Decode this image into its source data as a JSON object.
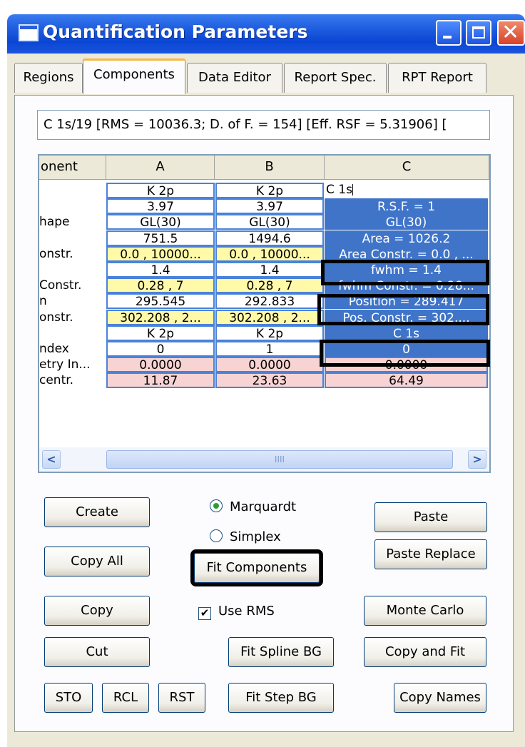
{
  "window": {
    "title": "Quantification Parameters"
  },
  "tabs": [
    "Regions",
    "Components",
    "Data Editor",
    "Report Spec.",
    "RPT Report"
  ],
  "summary": "C 1s/19 [RMS = 10036.3; D. of F. = 154] [Eff. RSF = 5.31906] [",
  "grid": {
    "headers": [
      "onent",
      "A",
      "B",
      "C"
    ],
    "rows": [
      {
        "label": "",
        "a": "K 2p",
        "b": "K 2p",
        "c": "C 1s"
      },
      {
        "label": "",
        "a": "3.97",
        "b": "3.97",
        "c": "R.S.F. = 1"
      },
      {
        "label": "hape",
        "a": "GL(30)",
        "b": "GL(30)",
        "c": "GL(30)"
      },
      {
        "label": "",
        "a": "751.5",
        "b": "1494.6",
        "c": "Area = 1026.2"
      },
      {
        "label": "onstr.",
        "a": "0.0 , 10000...",
        "b": "0.0 , 10000...",
        "c": "Area Constr. = 0.0 , ..."
      },
      {
        "label": "",
        "a": "1.4",
        "b": "1.4",
        "c": "fwhm = 1.4"
      },
      {
        "label": "Constr.",
        "a": "0.28 , 7",
        "b": "0.28 , 7",
        "c": "fwhm Constr. = 0.28..."
      },
      {
        "label": "n",
        "a": "295.545",
        "b": "292.833",
        "c": "Position = 289.417"
      },
      {
        "label": "onstr.",
        "a": "302.208 , 2...",
        "b": "302.208 , 2...",
        "c": "Pos. Constr. = 302...."
      },
      {
        "label": "",
        "a": "K 2p",
        "b": "K 2p",
        "c": "C 1s"
      },
      {
        "label": "ndex",
        "a": "0",
        "b": "1",
        "c": "0"
      },
      {
        "label": "etry In...",
        "a": "0.0000",
        "b": "0.0000",
        "c": "0.0000"
      },
      {
        "label": "centr.",
        "a": "11.87",
        "b": "23.63",
        "c": "64.49"
      }
    ],
    "scroll_thumb": "IIII"
  },
  "buttons": {
    "create": "Create",
    "copy_all": "Copy All",
    "copy": "Copy",
    "cut": "Cut",
    "sto": "STO",
    "rcl": "RCL",
    "rst": "RST",
    "fit_components": "Fit Components",
    "fit_spline_bg": "Fit Spline BG",
    "fit_step_bg": "Fit Step BG",
    "paste": "Paste",
    "paste_replace": "Paste Replace",
    "monte_carlo": "Monte Carlo",
    "copy_and_fit": "Copy and Fit",
    "copy_names": "Copy Names"
  },
  "options": {
    "marquardt": "Marquardt",
    "simplex": "Simplex",
    "use_rms": "Use RMS",
    "selected_method": "Marquardt",
    "use_rms_checked": true
  }
}
